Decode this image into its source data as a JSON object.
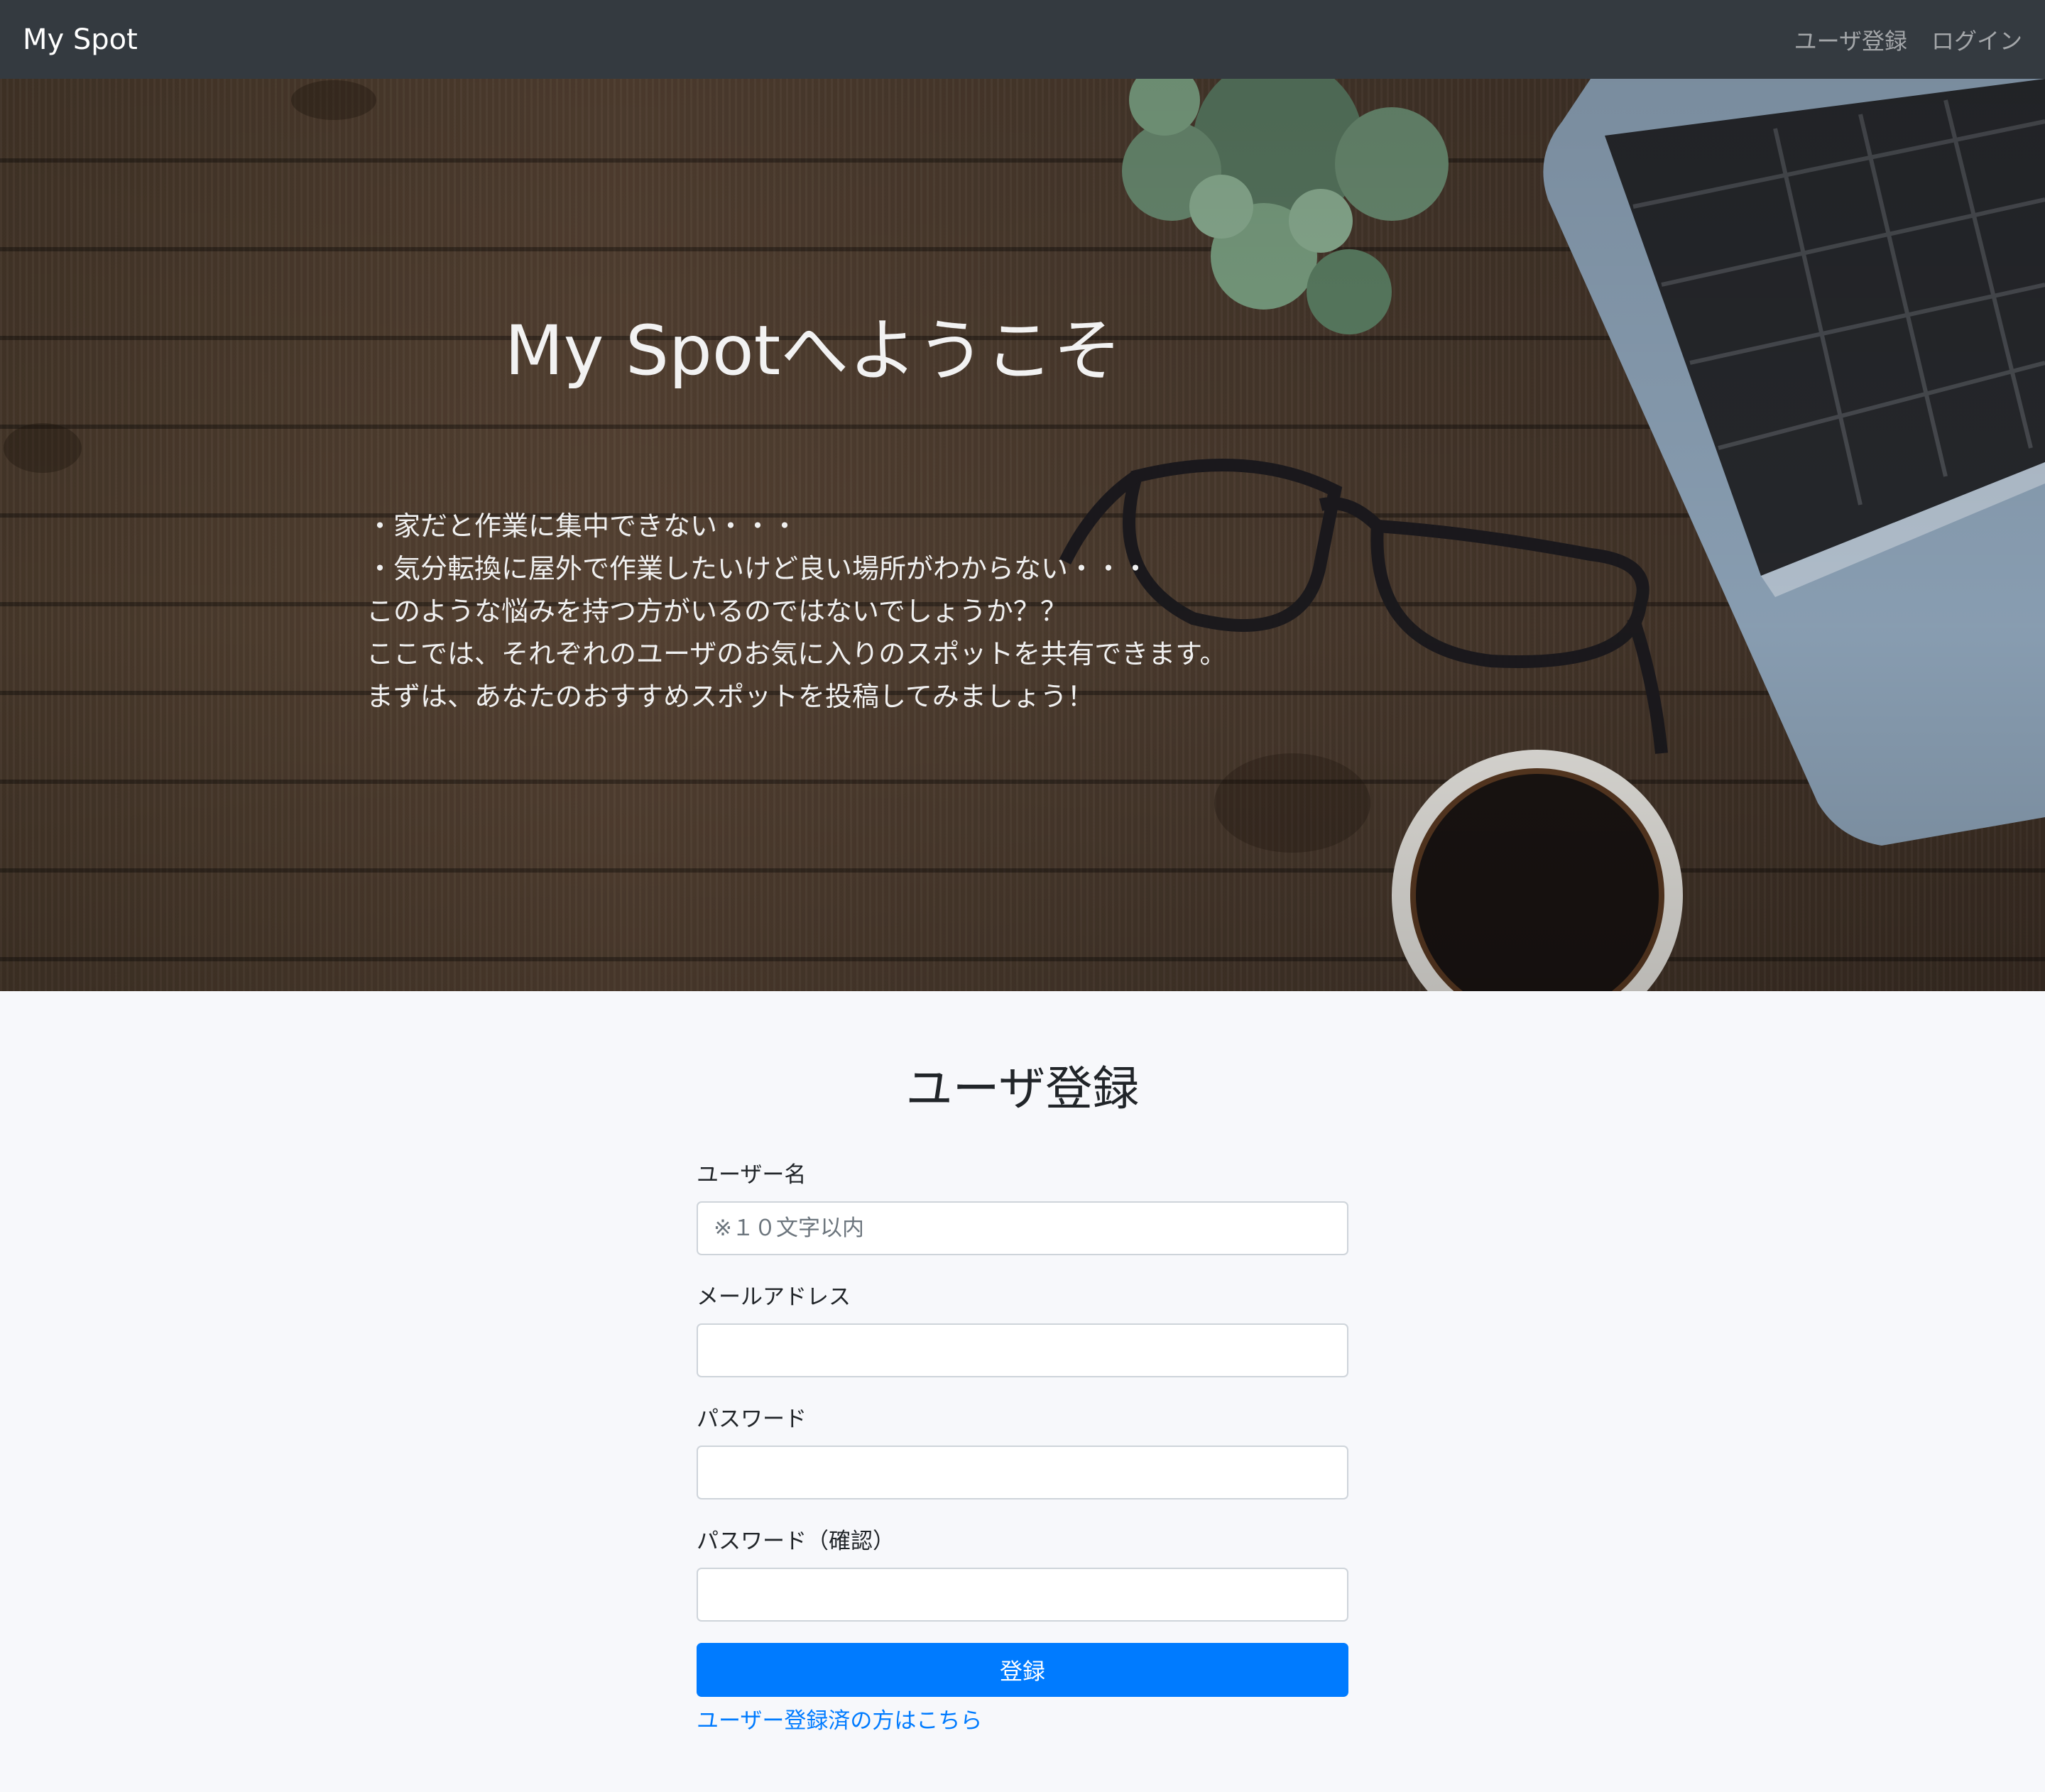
{
  "navbar": {
    "brand": "My Spot",
    "links": [
      "ユーザ登録",
      "ログイン"
    ]
  },
  "hero": {
    "title": "My Spotへようこそ",
    "lines": [
      "・家だと作業に集中できない・・・",
      "・気分転換に屋外で作業したいけど良い場所がわからない・・・",
      "このような悩みを持つ方がいるのではないでしょうか？？",
      "ここでは、それぞれのユーザのお気に入りのスポットを共有できます。",
      "まずは、あなたのおすすめスポットを投稿してみましょう！"
    ]
  },
  "form": {
    "title": "ユーザ登録",
    "username_label": "ユーザー名",
    "username_placeholder": "※１０文字以内",
    "email_label": "メールアドレス",
    "password_label": "パスワード",
    "password_confirm_label": "パスワード（確認）",
    "submit_label": "登録",
    "login_link": "ユーザー登録済の方はこちら"
  },
  "colors": {
    "navbar_bg": "#343a40",
    "primary": "#007bff",
    "page_bg": "#f7f8fb"
  }
}
